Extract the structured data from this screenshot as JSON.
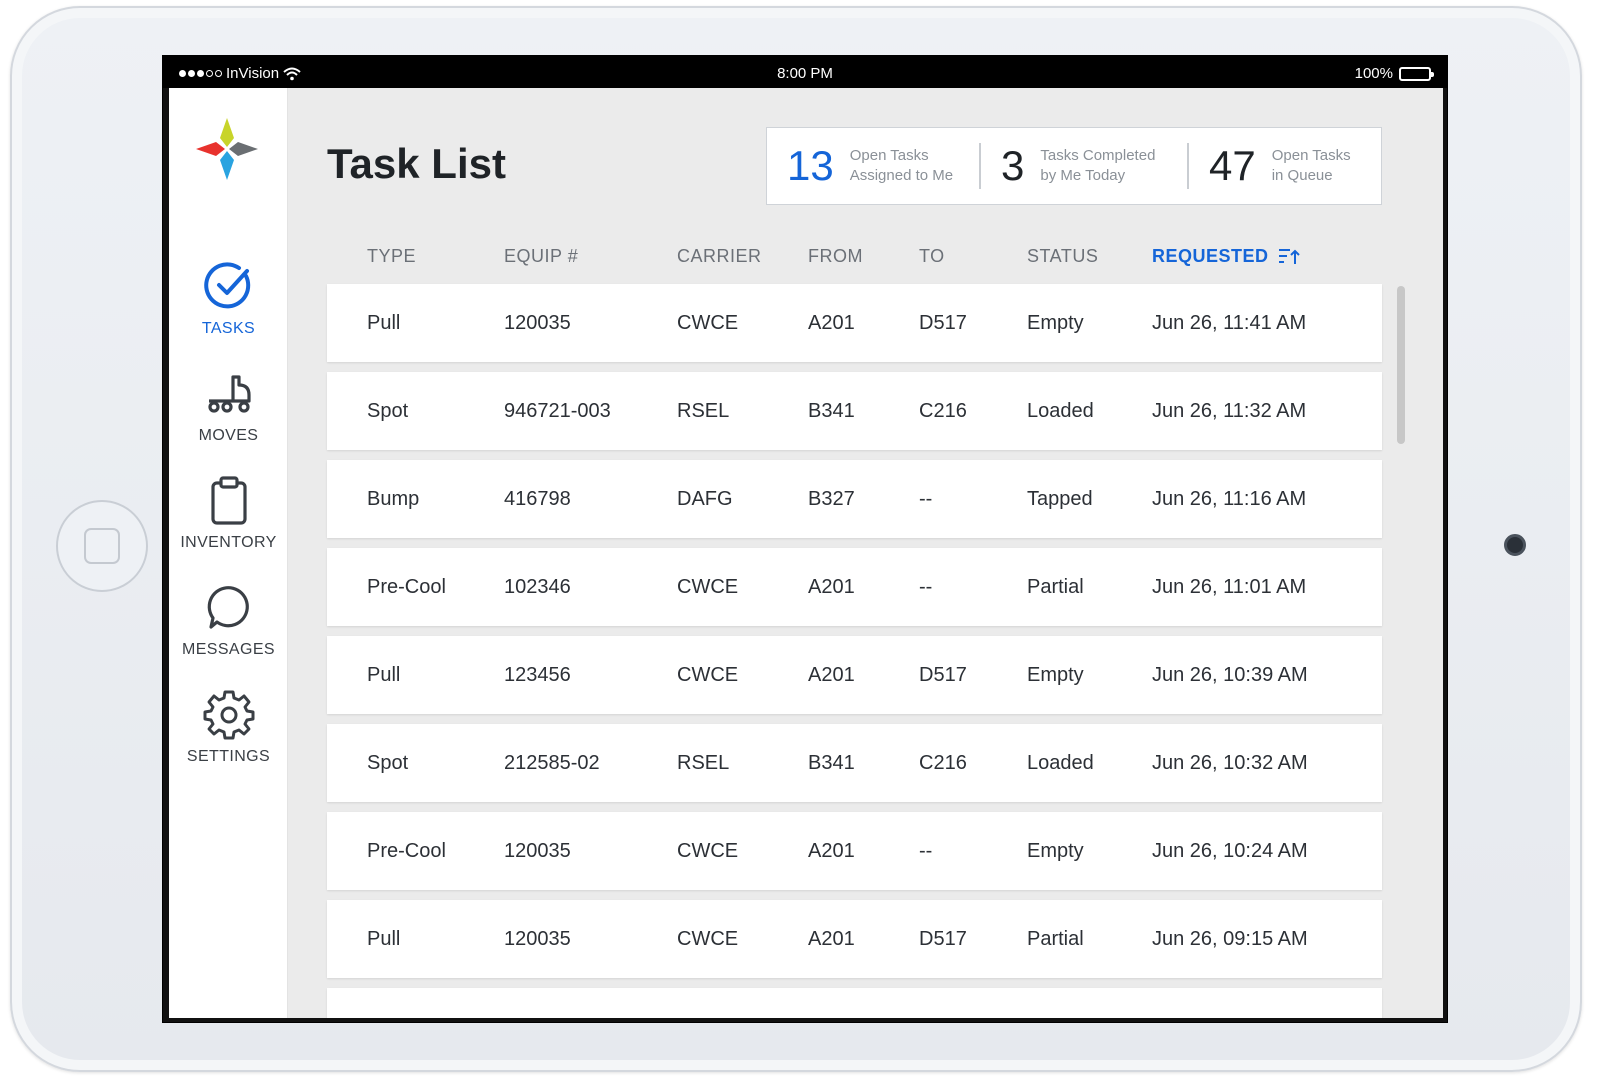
{
  "statusbar": {
    "carrier": "InVision",
    "time": "8:00 PM",
    "battery": "100%"
  },
  "sidebar": {
    "items": [
      {
        "label": "TASKS",
        "icon": "check-circle-icon",
        "active": true
      },
      {
        "label": "MOVES",
        "icon": "truck-icon",
        "active": false
      },
      {
        "label": "INVENTORY",
        "icon": "clipboard-icon",
        "active": false
      },
      {
        "label": "MESSAGES",
        "icon": "chat-bubble-icon",
        "active": false
      },
      {
        "label": "SETTINGS",
        "icon": "gear-icon",
        "active": false
      }
    ]
  },
  "page": {
    "title": "Task List"
  },
  "stats": [
    {
      "value": "13",
      "label": "Open Tasks\nAssigned to Me"
    },
    {
      "value": "3",
      "label": "Tasks Completed\nby Me Today"
    },
    {
      "value": "47",
      "label": "Open Tasks\nin Queue"
    }
  ],
  "table": {
    "columns": [
      "TYPE",
      "EQUIP #",
      "CARRIER",
      "FROM",
      "TO",
      "STATUS",
      "REQUESTED"
    ],
    "sort_icon": "sort-ascending-icon",
    "rows": [
      {
        "type": "Pull",
        "equip": "120035",
        "carrier": "CWCE",
        "from": "A201",
        "to": "D517",
        "status": "Empty",
        "requested": "Jun 26, 11:41 AM"
      },
      {
        "type": "Spot",
        "equip": "946721-003",
        "carrier": "RSEL",
        "from": "B341",
        "to": "C216",
        "status": "Loaded",
        "requested": "Jun 26, 11:32 AM"
      },
      {
        "type": "Bump",
        "equip": "416798",
        "carrier": "DAFG",
        "from": "B327",
        "to": "--",
        "status": "Tapped",
        "requested": "Jun 26, 11:16 AM"
      },
      {
        "type": "Pre-Cool",
        "equip": "102346",
        "carrier": "CWCE",
        "from": "A201",
        "to": "--",
        "status": "Partial",
        "requested": "Jun 26, 11:01 AM"
      },
      {
        "type": "Pull",
        "equip": "123456",
        "carrier": "CWCE",
        "from": "A201",
        "to": "D517",
        "status": "Empty",
        "requested": "Jun 26, 10:39 AM"
      },
      {
        "type": "Spot",
        "equip": "212585-02",
        "carrier": "RSEL",
        "from": "B341",
        "to": "C216",
        "status": "Loaded",
        "requested": "Jun 26, 10:32 AM"
      },
      {
        "type": "Pre-Cool",
        "equip": "120035",
        "carrier": "CWCE",
        "from": "A201",
        "to": "--",
        "status": "Empty",
        "requested": "Jun 26, 10:24 AM"
      },
      {
        "type": "Pull",
        "equip": "120035",
        "carrier": "CWCE",
        "from": "A201",
        "to": "D517",
        "status": "Partial",
        "requested": "Jun 26, 09:15 AM"
      }
    ]
  },
  "colors": {
    "accent": "#1565d8",
    "background": "#ebebeb",
    "text": "#2c3036"
  }
}
